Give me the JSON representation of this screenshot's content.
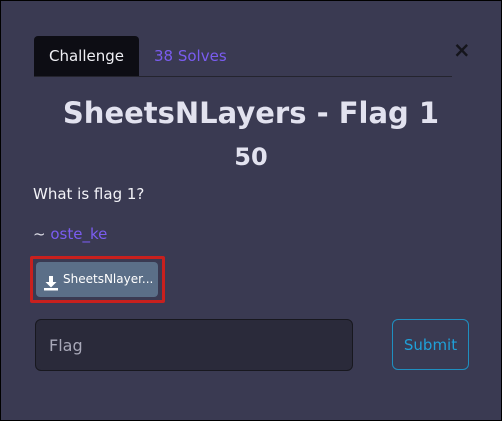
{
  "close_label": "×",
  "tabs": [
    {
      "label": "Challenge"
    },
    {
      "label": "38 Solves"
    }
  ],
  "challenge": {
    "title": "SheetsNLayers - Flag 1",
    "value": "50",
    "description": "What is flag 1?",
    "author_prefix": "~ ",
    "author": "oste_ke"
  },
  "file": {
    "label": "SheetsNlayer...",
    "icon": "download-icon"
  },
  "form": {
    "flag_placeholder": "Flag",
    "flag_value": "",
    "submit_label": "Submit"
  },
  "colors": {
    "modal_bg": "#3a3a52",
    "accent": "#7a5cf0",
    "file_button": "#5b6f88",
    "highlight": "#c8201e",
    "submit": "#1fa0d8"
  }
}
